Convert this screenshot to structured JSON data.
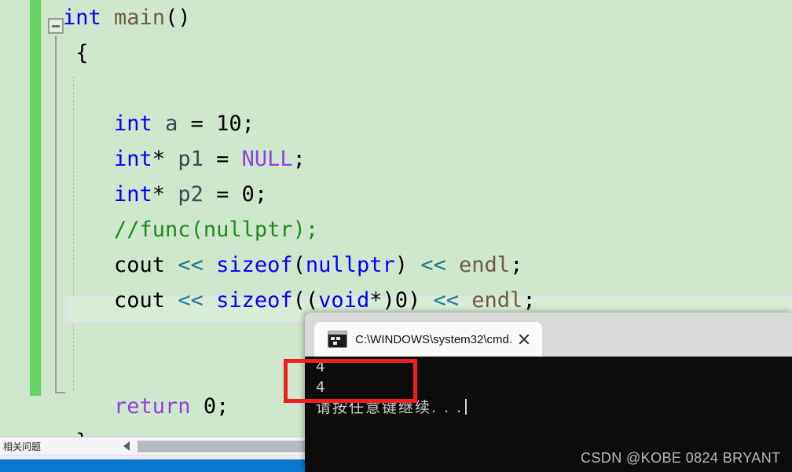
{
  "editor": {
    "name": "visual-studio-code-editor",
    "background_color": "#cfe8cd",
    "change_bar_color": "#68d367",
    "fold_state": "expanded",
    "colors": {
      "type_keyword": "#0000ff",
      "function": "#6f5b3e",
      "macro": "#8f3fe0",
      "comment": "#1d8a1d",
      "operator": "#1a7f8e",
      "variable": "#3b4a52",
      "plain": "#000000"
    },
    "lines": [
      {
        "id": "line-int-main",
        "tokens": [
          {
            "t": "int",
            "c": "k-type"
          },
          {
            "t": " ",
            "c": "k-plain"
          },
          {
            "t": "main",
            "c": "k-func"
          },
          {
            "t": "()",
            "c": "k-plain"
          }
        ]
      },
      {
        "id": "line-open-brace",
        "tokens": [
          {
            "t": " {",
            "c": "k-plain"
          }
        ]
      },
      {
        "id": "line-blank-1",
        "tokens": [
          {
            "t": "",
            "c": "k-plain"
          }
        ]
      },
      {
        "id": "line-int-a",
        "tokens": [
          {
            "t": "    ",
            "c": "k-plain"
          },
          {
            "t": "int",
            "c": "k-type"
          },
          {
            "t": " ",
            "c": "k-plain"
          },
          {
            "t": "a",
            "c": "k-var"
          },
          {
            "t": " = ",
            "c": "k-plain"
          },
          {
            "t": "10",
            "c": "k-plain"
          },
          {
            "t": ";",
            "c": "k-plain"
          }
        ]
      },
      {
        "id": "line-int-p1",
        "tokens": [
          {
            "t": "    ",
            "c": "k-plain"
          },
          {
            "t": "int",
            "c": "k-type"
          },
          {
            "t": "* ",
            "c": "k-plain"
          },
          {
            "t": "p1",
            "c": "k-var"
          },
          {
            "t": " = ",
            "c": "k-plain"
          },
          {
            "t": "NULL",
            "c": "k-macro"
          },
          {
            "t": ";",
            "c": "k-plain"
          }
        ]
      },
      {
        "id": "line-int-p2",
        "tokens": [
          {
            "t": "    ",
            "c": "k-plain"
          },
          {
            "t": "int",
            "c": "k-type"
          },
          {
            "t": "* ",
            "c": "k-plain"
          },
          {
            "t": "p2",
            "c": "k-var"
          },
          {
            "t": " = ",
            "c": "k-plain"
          },
          {
            "t": "0",
            "c": "k-plain"
          },
          {
            "t": ";",
            "c": "k-plain"
          }
        ]
      },
      {
        "id": "line-comment-func",
        "tokens": [
          {
            "t": "    ",
            "c": "k-plain"
          },
          {
            "t": "//func(nullptr);",
            "c": "k-comment"
          }
        ]
      },
      {
        "id": "line-cout-sizeof-nullptr",
        "tokens": [
          {
            "t": "    ",
            "c": "k-plain"
          },
          {
            "t": "cout",
            "c": "k-plain"
          },
          {
            "t": " ",
            "c": "k-plain"
          },
          {
            "t": "<<",
            "c": "k-op"
          },
          {
            "t": " ",
            "c": "k-plain"
          },
          {
            "t": "sizeof",
            "c": "k-type"
          },
          {
            "t": "(",
            "c": "k-plain"
          },
          {
            "t": "nullptr",
            "c": "k-type"
          },
          {
            "t": ")",
            "c": "k-plain"
          },
          {
            "t": " ",
            "c": "k-plain"
          },
          {
            "t": "<<",
            "c": "k-op"
          },
          {
            "t": " ",
            "c": "k-plain"
          },
          {
            "t": "endl",
            "c": "k-func"
          },
          {
            "t": ";",
            "c": "k-plain"
          }
        ]
      },
      {
        "id": "line-cout-sizeof-voidptr",
        "tokens": [
          {
            "t": "    ",
            "c": "k-plain"
          },
          {
            "t": "cout",
            "c": "k-plain"
          },
          {
            "t": " ",
            "c": "k-plain"
          },
          {
            "t": "<<",
            "c": "k-op"
          },
          {
            "t": " ",
            "c": "k-plain"
          },
          {
            "t": "sizeof",
            "c": "k-type"
          },
          {
            "t": "((",
            "c": "k-plain"
          },
          {
            "t": "void",
            "c": "k-type"
          },
          {
            "t": "*)",
            "c": "k-plain"
          },
          {
            "t": "0",
            "c": "k-plain"
          },
          {
            "t": ")",
            "c": "k-plain"
          },
          {
            "t": " ",
            "c": "k-plain"
          },
          {
            "t": "<<",
            "c": "k-op"
          },
          {
            "t": " ",
            "c": "k-plain"
          },
          {
            "t": "endl",
            "c": "k-func"
          },
          {
            "t": ";",
            "c": "k-plain"
          }
        ]
      },
      {
        "id": "line-current-empty",
        "current": true,
        "tokens": [
          {
            "t": "",
            "c": "k-plain"
          }
        ]
      },
      {
        "id": "line-blank-2",
        "tokens": [
          {
            "t": "",
            "c": "k-plain"
          }
        ]
      },
      {
        "id": "line-return",
        "tokens": [
          {
            "t": "    ",
            "c": "k-plain"
          },
          {
            "t": "return",
            "c": "k-macro"
          },
          {
            "t": " ",
            "c": "k-plain"
          },
          {
            "t": "0",
            "c": "k-plain"
          },
          {
            "t": ";",
            "c": "k-plain"
          }
        ]
      },
      {
        "id": "line-close-brace",
        "tokens": [
          {
            "t": " }",
            "c": "k-plain"
          }
        ]
      }
    ]
  },
  "bottom": {
    "related_label": "相关问题",
    "scroll_left_arrow": "left-arrow-icon",
    "status_bar_color": "#0a78ce"
  },
  "terminal": {
    "window_title": "C:\\WINDOWS\\system32\\cmd.",
    "tab": {
      "label": "C:\\WINDOWS\\system32\\cmd.",
      "icon": "cmd-console-icon",
      "close_icon": "close-icon"
    },
    "new_tab_icon": "plus-icon",
    "dropdown_icon": "chevron-down-icon",
    "background_color": "#0c0c0c",
    "output": [
      {
        "id": "out-line-1",
        "text": "4"
      },
      {
        "id": "out-line-2",
        "text": "4"
      },
      {
        "id": "out-line-3",
        "text": "请按任意键继续. . .",
        "cjk": true,
        "cursor": true
      }
    ]
  },
  "annotation": {
    "red_box": {
      "color": "#f01f1f",
      "encloses": "terminal output values 4 and 4"
    }
  },
  "watermark": {
    "text": "CSDN @KOBE 0824 BRYANT"
  }
}
